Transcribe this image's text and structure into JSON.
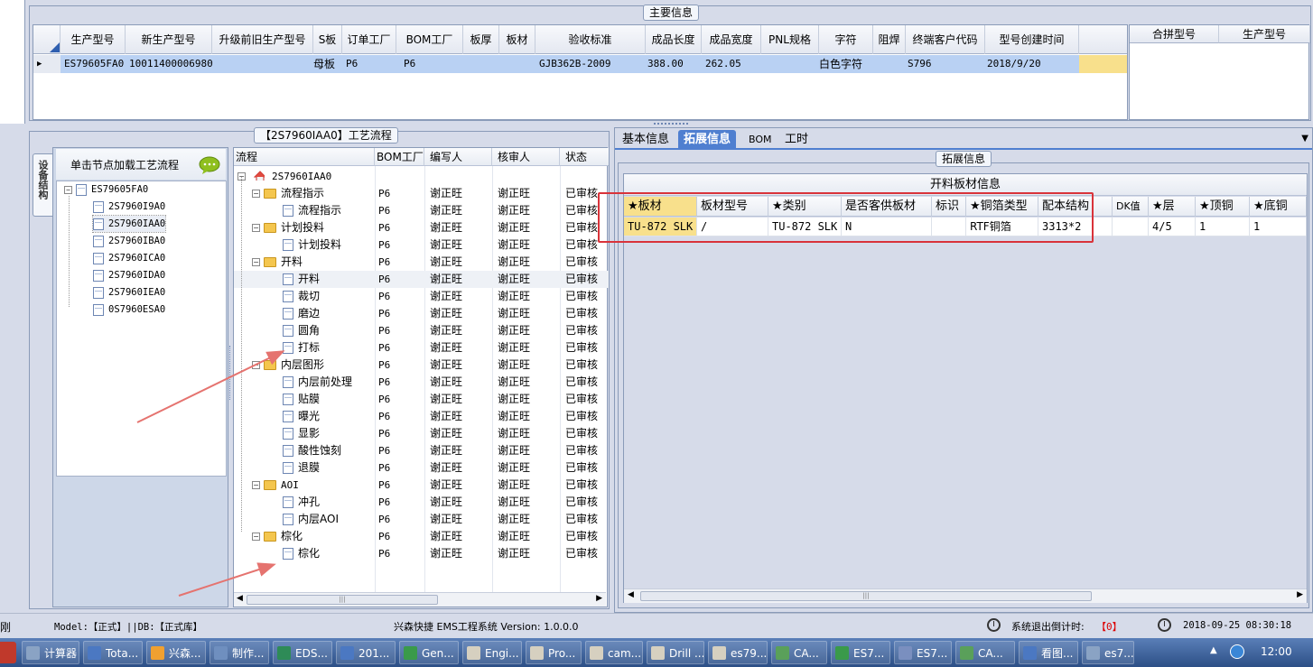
{
  "main_info": {
    "caption": "主要信息",
    "columns": [
      "生产型号",
      "新生产型号",
      "升级前旧生产型号",
      "S板",
      "订单工厂",
      "BOM工厂",
      "板厚",
      "板材",
      "验收标准",
      "成品长度",
      "成品宽度",
      "PNL规格",
      "字符",
      "阻焊",
      "终端客户代码",
      "型号创建时间"
    ],
    "row": {
      "prod_model": "ES79605FA0",
      "new_model": "10011400006980",
      "s_board": "母板",
      "order_factory": "P6",
      "bom_factory": "P6",
      "standard": "GJB362B-2009",
      "length": "388.00",
      "width": "262.05",
      "char": "白色字符",
      "customer": "S796",
      "created": "2018/9/20"
    },
    "merge_columns": [
      "合拼型号",
      "生产型号"
    ]
  },
  "process": {
    "caption": "【2S7960IAA0】工艺流程",
    "load_hint": "单击节点加载工艺流程",
    "vtab_label": "设备结构",
    "struct_tree": {
      "root": "ES79605FA0",
      "children": [
        "2S7960I9A0",
        "2S7960IAA0",
        "2S7960IBA0",
        "2S7960ICA0",
        "2S7960IDA0",
        "2S7960IEA0",
        "0S7960ESA0"
      ]
    },
    "columns": [
      "流程",
      "BOM工厂",
      "编写人",
      "核审人",
      "状态"
    ],
    "root": "2S7960IAA0",
    "rows": [
      {
        "name": "流程指示",
        "level": 1,
        "type": "folder",
        "bom": "P6",
        "writer": "谢正旺",
        "reviewer": "谢正旺",
        "status": "已审核"
      },
      {
        "name": "流程指示",
        "level": 2,
        "type": "doc",
        "bom": "P6",
        "writer": "谢正旺",
        "reviewer": "谢正旺",
        "status": "已审核"
      },
      {
        "name": "计划投料",
        "level": 1,
        "type": "folder",
        "bom": "P6",
        "writer": "谢正旺",
        "reviewer": "谢正旺",
        "status": "已审核"
      },
      {
        "name": "计划投料",
        "level": 2,
        "type": "doc",
        "bom": "P6",
        "writer": "谢正旺",
        "reviewer": "谢正旺",
        "status": "已审核"
      },
      {
        "name": "开料",
        "level": 1,
        "type": "folder",
        "bom": "P6",
        "writer": "谢正旺",
        "reviewer": "谢正旺",
        "status": "已审核"
      },
      {
        "name": "开料",
        "level": 2,
        "type": "doc",
        "bom": "P6",
        "writer": "谢正旺",
        "reviewer": "谢正旺",
        "status": "已审核"
      },
      {
        "name": "裁切",
        "level": 2,
        "type": "doc",
        "bom": "P6",
        "writer": "谢正旺",
        "reviewer": "谢正旺",
        "status": "已审核"
      },
      {
        "name": "磨边",
        "level": 2,
        "type": "doc",
        "bom": "P6",
        "writer": "谢正旺",
        "reviewer": "谢正旺",
        "status": "已审核"
      },
      {
        "name": "圆角",
        "level": 2,
        "type": "doc",
        "bom": "P6",
        "writer": "谢正旺",
        "reviewer": "谢正旺",
        "status": "已审核"
      },
      {
        "name": "打标",
        "level": 2,
        "type": "doc",
        "bom": "P6",
        "writer": "谢正旺",
        "reviewer": "谢正旺",
        "status": "已审核"
      },
      {
        "name": "内层图形",
        "level": 1,
        "type": "folder",
        "bom": "P6",
        "writer": "谢正旺",
        "reviewer": "谢正旺",
        "status": "已审核"
      },
      {
        "name": "内层前处理",
        "level": 2,
        "type": "doc",
        "bom": "P6",
        "writer": "谢正旺",
        "reviewer": "谢正旺",
        "status": "已审核"
      },
      {
        "name": "贴膜",
        "level": 2,
        "type": "doc",
        "bom": "P6",
        "writer": "谢正旺",
        "reviewer": "谢正旺",
        "status": "已审核"
      },
      {
        "name": "曝光",
        "level": 2,
        "type": "doc",
        "bom": "P6",
        "writer": "谢正旺",
        "reviewer": "谢正旺",
        "status": "已审核"
      },
      {
        "name": "显影",
        "level": 2,
        "type": "doc",
        "bom": "P6",
        "writer": "谢正旺",
        "reviewer": "谢正旺",
        "status": "已审核"
      },
      {
        "name": "酸性蚀刻",
        "level": 2,
        "type": "doc",
        "bom": "P6",
        "writer": "谢正旺",
        "reviewer": "谢正旺",
        "status": "已审核"
      },
      {
        "name": "退膜",
        "level": 2,
        "type": "doc",
        "bom": "P6",
        "writer": "谢正旺",
        "reviewer": "谢正旺",
        "status": "已审核"
      },
      {
        "name": "AOI",
        "level": 1,
        "type": "folder",
        "bom": "P6",
        "writer": "谢正旺",
        "reviewer": "谢正旺",
        "status": "已审核"
      },
      {
        "name": "冲孔",
        "level": 2,
        "type": "doc",
        "bom": "P6",
        "writer": "谢正旺",
        "reviewer": "谢正旺",
        "status": "已审核"
      },
      {
        "name": "内层AOI",
        "level": 2,
        "type": "doc",
        "bom": "P6",
        "writer": "谢正旺",
        "reviewer": "谢正旺",
        "status": "已审核"
      },
      {
        "name": "棕化",
        "level": 1,
        "type": "folder",
        "bom": "P6",
        "writer": "谢正旺",
        "reviewer": "谢正旺",
        "status": "已审核"
      },
      {
        "name": "棕化",
        "level": 2,
        "type": "doc",
        "bom": "P6",
        "writer": "谢正旺",
        "reviewer": "谢正旺",
        "status": "已审核"
      }
    ]
  },
  "right": {
    "tabs": [
      "基本信息",
      "拓展信息",
      "BOM",
      "工时"
    ],
    "active_tab": "拓展信息",
    "ext_caption": "拓展信息",
    "board_title": "开料板材信息",
    "board_columns": [
      "★板材",
      "板材型号",
      "★类别",
      "是否客供板材",
      "标识",
      "★铜箔类型",
      "配本结构",
      "DK值",
      "★层",
      "★顶铜",
      "★底铜"
    ],
    "board_row": [
      "TU-872 SLK",
      "/",
      "TU-872 SLK",
      "N",
      "",
      "RTF铜箔",
      "3313*2",
      "",
      "4/5",
      "1",
      "1"
    ]
  },
  "status": {
    "left_char": "刚",
    "model": "Model:【正式】||DB:【正式库】",
    "system": "兴森快捷 EMS工程系统 Version: 1.0.0.0",
    "countdown_label": "系统退出倒计时:",
    "countdown_value": "【0】",
    "datetime": "2018-09-25 08:30:18"
  },
  "taskbar": {
    "items": [
      "计算器",
      "Tota...",
      "兴森...",
      "制作...",
      "EDS...",
      "201...",
      "Gen...",
      "Engi...",
      "Pro...",
      "cam...",
      "Drill ...",
      "es79...",
      "CA...",
      "ES7...",
      "ES7...",
      "CA...",
      "看图...",
      "es7..."
    ],
    "clock": "12:00"
  },
  "colors": {
    "accent": "#4f7fd0",
    "highlight_row": "#b9d1f3",
    "selected_cell": "#f8e08c",
    "annotation_red": "#d9333a"
  }
}
